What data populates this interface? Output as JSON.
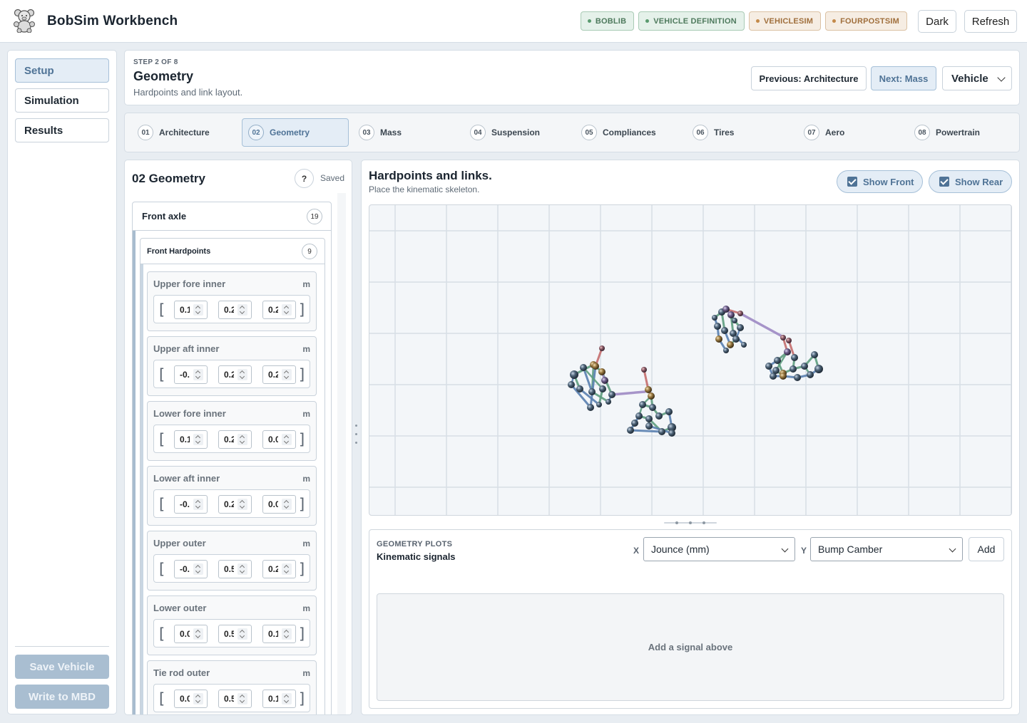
{
  "app": {
    "title": "BobSim Workbench",
    "badges": [
      {
        "label": "BOBLIB",
        "status": "ok"
      },
      {
        "label": "VEHICLE DEFINITION",
        "status": "ok"
      },
      {
        "label": "VEHICLESIM",
        "status": "warn"
      },
      {
        "label": "FOURPOSTSIM",
        "status": "warn"
      }
    ],
    "theme_button": "Dark",
    "refresh_button": "Refresh",
    "colors": {
      "accent": "#4f7396",
      "ok": "#5a9a6f",
      "warn": "#c48a4a"
    }
  },
  "rail": {
    "items": [
      {
        "label": "Setup",
        "active": true
      },
      {
        "label": "Simulation",
        "active": false
      },
      {
        "label": "Results",
        "active": false
      }
    ],
    "save_vehicle": "Save Vehicle",
    "write_mbd": "Write to MBD"
  },
  "step": {
    "kicker": "STEP 2 OF 8",
    "title": "Geometry",
    "description": "Hardpoints and link layout.",
    "prev_button": "Previous: Architecture",
    "next_button": "Next: Mass",
    "context_select": "Vehicle"
  },
  "tabs": [
    {
      "num": "01",
      "label": "Architecture"
    },
    {
      "num": "02",
      "label": "Geometry"
    },
    {
      "num": "03",
      "label": "Mass"
    },
    {
      "num": "04",
      "label": "Suspension"
    },
    {
      "num": "05",
      "label": "Compliances"
    },
    {
      "num": "06",
      "label": "Tires"
    },
    {
      "num": "07",
      "label": "Aero"
    },
    {
      "num": "08",
      "label": "Powertrain"
    }
  ],
  "editor": {
    "title": "02 Geometry",
    "help": "?",
    "status": "Saved",
    "axle": {
      "label": "Front axle",
      "count": "19"
    },
    "group": {
      "label": "Front Hardpoints",
      "count": "9"
    },
    "hardpoints": [
      {
        "label": "Upper fore inner",
        "unit": "m",
        "values": [
          "0.1",
          "0.2",
          "0.2"
        ]
      },
      {
        "label": "Upper aft inner",
        "unit": "m",
        "values": [
          "-0.",
          "0.2",
          "0.2"
        ]
      },
      {
        "label": "Lower fore inner",
        "unit": "m",
        "values": [
          "0.1",
          "0.2",
          "0.0"
        ]
      },
      {
        "label": "Lower aft inner",
        "unit": "m",
        "values": [
          "-0.",
          "0.2",
          "0.0"
        ]
      },
      {
        "label": "Upper outer",
        "unit": "m",
        "values": [
          "-0.",
          "0.5",
          "0.2"
        ]
      },
      {
        "label": "Lower outer",
        "unit": "m",
        "values": [
          "0.0",
          "0.5",
          "0.1"
        ]
      },
      {
        "label": "Tie rod outer",
        "unit": "m",
        "values": [
          "0.0",
          "0.5",
          "0.1"
        ]
      }
    ]
  },
  "viewer": {
    "title": "Hardpoints and links.",
    "subtitle": "Place the kinematic skeleton.",
    "show_front": {
      "label": "Show Front",
      "checked": true
    },
    "show_rear": {
      "label": "Show Rear",
      "checked": true
    }
  },
  "plots": {
    "kicker": "GEOMETRY PLOTS",
    "title": "Kinematic signals",
    "x_label": "X",
    "x_value": "Jounce (mm)",
    "y_label": "Y",
    "y_value": "Bump Camber",
    "add_button": "Add",
    "empty_text": "Add a signal above"
  }
}
